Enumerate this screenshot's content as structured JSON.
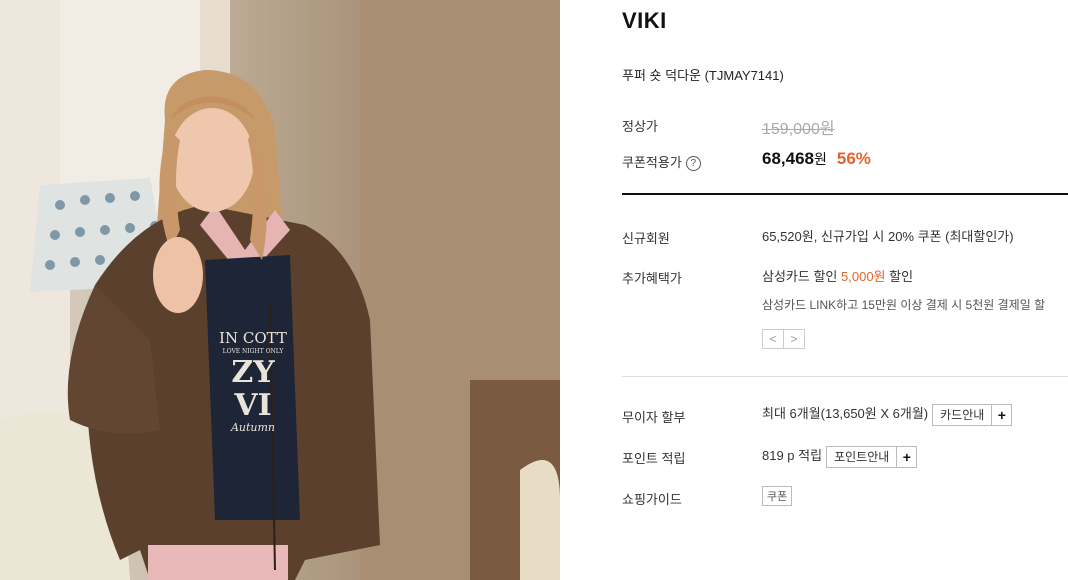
{
  "product": {
    "brand": "VIKI",
    "name": "푸퍼 숏 덕다운 (TJMAY7141)"
  },
  "prices": {
    "regular_label": "정상가",
    "regular_value": "159,000원",
    "coupon_label": "쿠폰적용가",
    "help_icon": "?",
    "coupon_price": "68,468",
    "coupon_unit": "원",
    "discount_rate": "56%"
  },
  "benefits": {
    "new_member_label": "신규회원",
    "new_member_value": "65,520원, 신규가입 시 20% 쿠폰 (최대할인가)",
    "extra_label": "추가혜택가",
    "extra_card": "삼성카드",
    "extra_discount_word": "할인",
    "extra_amount": "5,000원",
    "extra_suffix": "할인",
    "extra_note": "삼성카드 LINK하고 15만원 이상 결제 시 5천원 결제일 할",
    "pager_prev": "<",
    "pager_next": ">"
  },
  "details": {
    "installment_label": "무이자 할부",
    "installment_value": "최대 6개월(13,650원 X 6개월)",
    "installment_button": "카드안내",
    "points_label": "포인트 적립",
    "points_value": "819 p 적립",
    "points_button": "포인트안내",
    "plus": "+",
    "guide_label": "쇼핑가이드",
    "guide_tag": "쿠폰"
  },
  "photo": {
    "sweater_lines": [
      "IN COTT",
      "LOVE NIGHT ONLY",
      "ZY VI",
      "Autumn"
    ]
  },
  "colors": {
    "accent": "#e4632a",
    "divider": "#111111"
  }
}
